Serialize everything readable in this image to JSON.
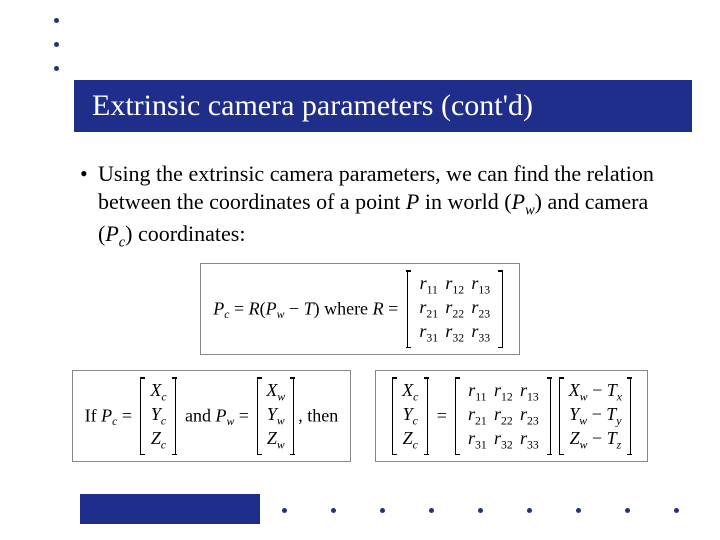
{
  "title": "Extrinsic camera parameters (cont'd)",
  "bullet_text_pre": "Using the extrinsic camera parameters, we can find the relation between the coordinates of a point ",
  "P": "P",
  "bullet_in_world": " in world (",
  "Pw": "P",
  "w": "w",
  "bullet_and_camera": ") and camera (",
  "Pc": "P",
  "c": "c",
  "bullet_tail": ") coordinates:",
  "eq1": {
    "lhs": "P",
    "lhs_sub": "c",
    "eq": " = ",
    "R": "R",
    "open": "(",
    "Pw": "P",
    "Pw_sub": "w",
    "minus": " − ",
    "T": "T",
    "close": ")",
    "where": " where ",
    "Req": " = ",
    "matrix": [
      [
        "r",
        "11",
        "r",
        "12",
        "r",
        "13"
      ],
      [
        "r",
        "21",
        "r",
        "22",
        "r",
        "23"
      ],
      [
        "r",
        "31",
        "r",
        "32",
        "r",
        "33"
      ]
    ]
  },
  "eq2": {
    "if": "If ",
    "Pc": "P",
    "Pc_sub": "c",
    "eq": " = ",
    "vec_pc": [
      [
        "X",
        "c"
      ],
      [
        "Y",
        "c"
      ],
      [
        "Z",
        "c"
      ]
    ],
    "and": " and ",
    "Pw": "P",
    "Pw_sub": "w",
    "vec_pw": [
      [
        "X",
        "w"
      ],
      [
        "Y",
        "w"
      ],
      [
        "Z",
        "w"
      ]
    ],
    "then": ", then",
    "vec_lhs": [
      [
        "X",
        "c"
      ],
      [
        "Y",
        "c"
      ],
      [
        "Z",
        "c"
      ]
    ],
    "Rmat": [
      [
        "r",
        "11",
        "r",
        "12",
        "r",
        "13"
      ],
      [
        "r",
        "21",
        "r",
        "22",
        "r",
        "23"
      ],
      [
        "r",
        "31",
        "r",
        "32",
        "r",
        "33"
      ]
    ],
    "vec_rhs": [
      [
        "X",
        "w",
        " − ",
        "T",
        "x"
      ],
      [
        "Y",
        "w",
        " − ",
        "T",
        "y"
      ],
      [
        "Z",
        "w",
        " − ",
        "T",
        "z"
      ]
    ]
  }
}
